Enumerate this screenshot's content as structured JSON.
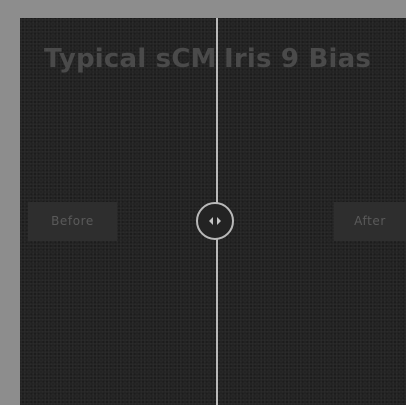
{
  "comparison": {
    "title": "Typical sCMOS Iris 9 Bias",
    "title_left_fragment": "Typical sCMO",
    "title_right_fragment": "Iris 9 Bias",
    "before_label": "Before",
    "after_label": "After",
    "slider_position_fraction": 0.51,
    "handle_icon": "left-right-arrows-icon"
  },
  "colors": {
    "background": "#8d8d8d",
    "stage": "#232323",
    "divider": "#b9b9b9",
    "title_text": "#4a4a4a",
    "label_bg": "#2e2e2e",
    "label_text": "#5a5a5a"
  }
}
